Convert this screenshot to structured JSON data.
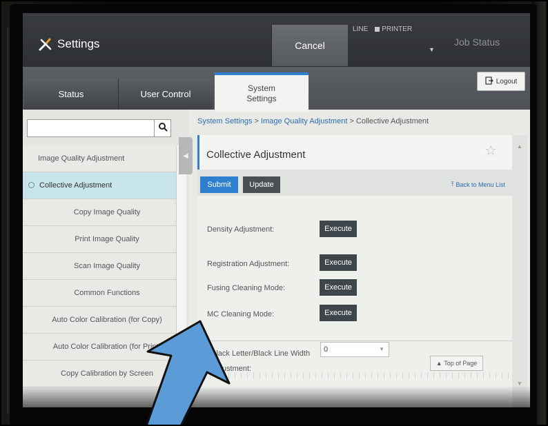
{
  "header": {
    "title": "Settings",
    "cancel_label": "Cancel",
    "indicator_line": "LINE",
    "indicator_printer": "PRINTER",
    "job_status": "Job Status"
  },
  "tabs": {
    "status": "Status",
    "user_control": "User Control",
    "system_settings_line1": "System",
    "system_settings_line2": "Settings",
    "logout": "Logout"
  },
  "search": {
    "value": ""
  },
  "sidebar": {
    "items": [
      "Image Quality Adjustment",
      "Collective Adjustment",
      "Copy Image Quality",
      "Print Image Quality",
      "Scan Image Quality",
      "Common Functions",
      "Auto Color Calibration (for Copy)",
      "Auto Color Calibration (for Print)",
      "Copy Calibration by Screen"
    ],
    "active_index": 1
  },
  "breadcrumb": {
    "part1": "System Settings",
    "sep1": " > ",
    "part2": "Image Quality Adjustment",
    "sep2": " > ",
    "part3": "Collective Adjustment"
  },
  "panel": {
    "title": "Collective Adjustment",
    "submit": "Submit",
    "update": "Update",
    "back_link": "Back to Menu List",
    "rows": [
      {
        "label": "Density Adjustment:",
        "button": "Execute"
      },
      {
        "label": "Registration Adjustment:",
        "button": "Execute"
      },
      {
        "label": "Fusing Cleaning Mode:",
        "button": "Execute"
      },
      {
        "label": "MC Cleaning Mode:",
        "button": "Execute"
      }
    ],
    "bw_label": "Black Letter/Black Line Width Adjustment:",
    "bw_value": "0",
    "top_of_page": "Top of Page"
  },
  "colors": {
    "accent": "#2f7fd1",
    "arrow": "#5b9bd8"
  }
}
